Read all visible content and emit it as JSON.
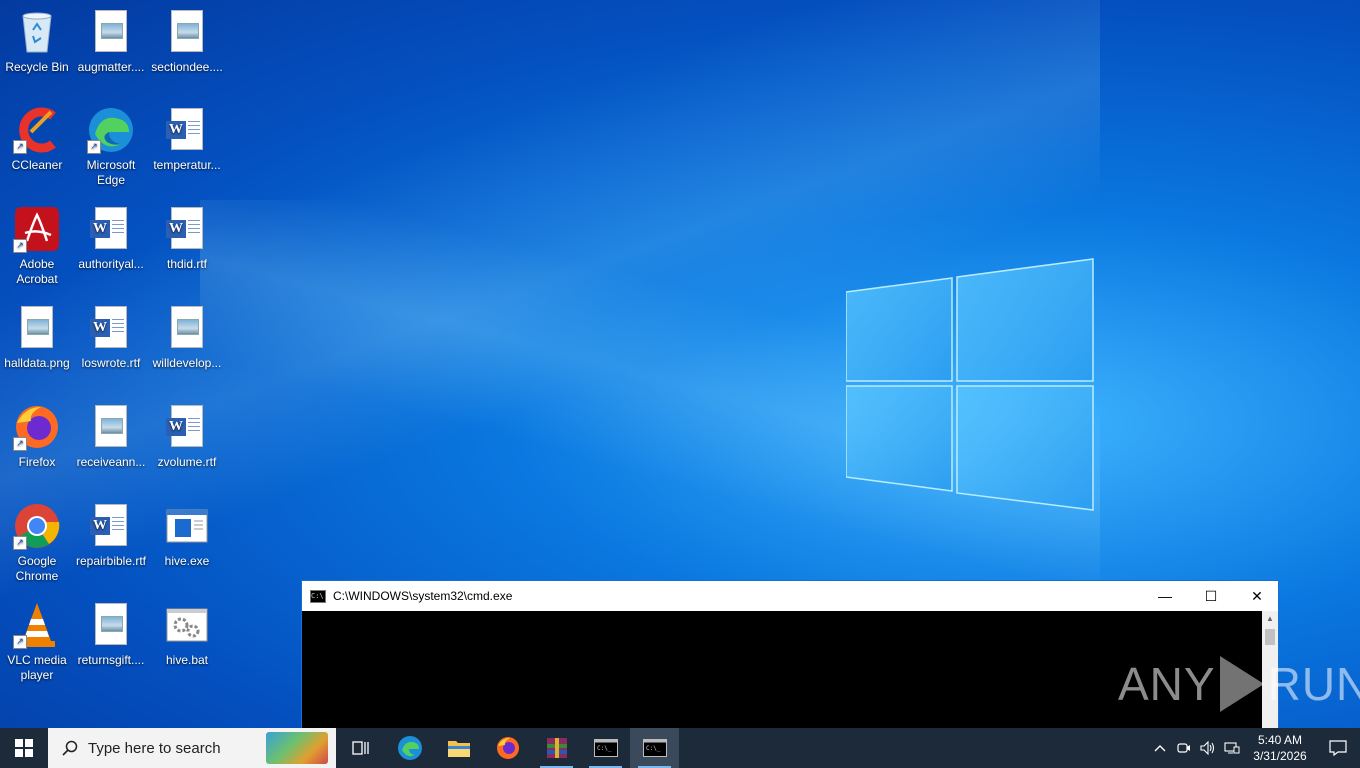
{
  "desktop": {
    "icons": [
      {
        "label": "Recycle Bin",
        "icon": "recycle-bin-icon"
      },
      {
        "label": "augmatter....",
        "icon": "image-file-icon"
      },
      {
        "label": "sectiondee....",
        "icon": "image-file-icon"
      },
      {
        "label": "CCleaner",
        "icon": "ccleaner-icon"
      },
      {
        "label": "Microsoft Edge",
        "icon": "edge-icon"
      },
      {
        "label": "temperatur...",
        "icon": "word-doc-icon"
      },
      {
        "label": "Adobe Acrobat",
        "icon": "acrobat-icon"
      },
      {
        "label": "authorityal...",
        "icon": "word-doc-icon"
      },
      {
        "label": "thdid.rtf",
        "icon": "word-doc-icon"
      },
      {
        "label": "halldata.png",
        "icon": "image-file-icon"
      },
      {
        "label": "loswrote.rtf",
        "icon": "word-doc-icon"
      },
      {
        "label": "willdevelop...",
        "icon": "image-file-icon"
      },
      {
        "label": "Firefox",
        "icon": "firefox-icon"
      },
      {
        "label": "receiveann...",
        "icon": "image-file-icon"
      },
      {
        "label": "zvolume.rtf",
        "icon": "word-doc-icon"
      },
      {
        "label": "Google Chrome",
        "icon": "chrome-icon"
      },
      {
        "label": "repairbible.rtf",
        "icon": "word-doc-icon"
      },
      {
        "label": "hive.exe",
        "icon": "exe-icon"
      },
      {
        "label": "VLC media player",
        "icon": "vlc-icon"
      },
      {
        "label": "returnsgift....",
        "icon": "image-file-icon"
      },
      {
        "label": "hive.bat",
        "icon": "bat-gear-icon"
      }
    ]
  },
  "cmd_window": {
    "title": "C:\\WINDOWS\\system32\\cmd.exe",
    "minimize": "—",
    "maximize": "☐",
    "close": "✕"
  },
  "watermark": {
    "left": "ANY",
    "right": "RUN"
  },
  "taskbar": {
    "search_placeholder": "Type here to search",
    "pinned": [
      "task-view",
      "edge",
      "file-explorer",
      "firefox",
      "winrar",
      "cmd",
      "cmd"
    ],
    "clock_time": "5:40 AM",
    "clock_date": "3/31/2026"
  }
}
